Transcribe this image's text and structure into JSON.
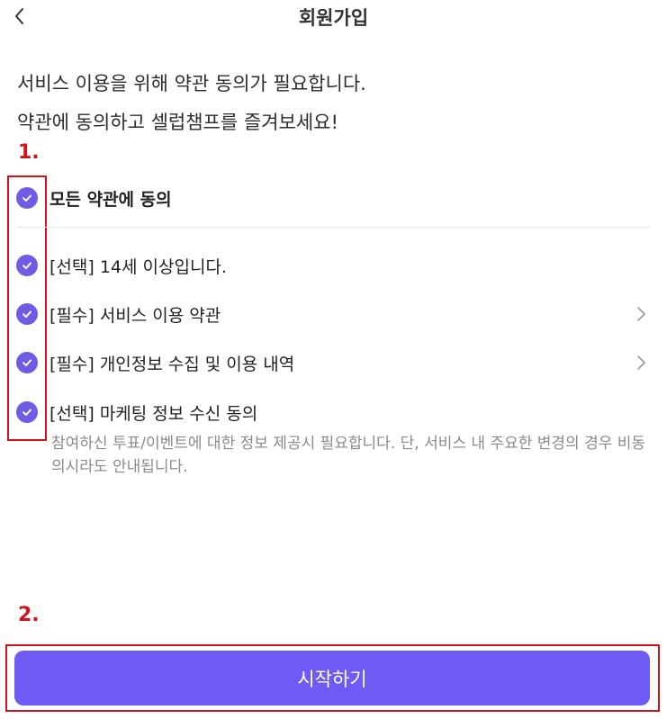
{
  "header": {
    "title": "회원가입",
    "back_icon": "chevron-left-icon"
  },
  "intro": {
    "line1": "서비스 이용을 위해 약관 동의가 필요합니다.",
    "line2": "약관에 동의하고 셀럽챔프를 즐겨보세요!"
  },
  "annotations": {
    "one": "1.",
    "two": "2."
  },
  "agree_all": {
    "label": "모든 약관에 동의",
    "checked": true
  },
  "terms": [
    {
      "label": "[선택] 14세 이상입니다.",
      "checked": true,
      "has_detail": false
    },
    {
      "label": "[필수] 서비스 이용 약관",
      "checked": true,
      "has_detail": true
    },
    {
      "label": "[필수] 개인정보 수집 및 이용 내역",
      "checked": true,
      "has_detail": true
    },
    {
      "label": "[선택] 마케팅 정보 수신 동의",
      "checked": true,
      "has_detail": false
    }
  ],
  "marketing_description": "참여하신 투표/이벤트에 대한 정보 제공시 필요합니다. 단, 서비스 내 주요한 변경의 경우 비동의시라도 안내됩니다.",
  "start_button": {
    "label": "시작하기"
  },
  "colors": {
    "accent": "#6f5af6",
    "check": "#6e5de4",
    "annotation": "#d0141e"
  }
}
